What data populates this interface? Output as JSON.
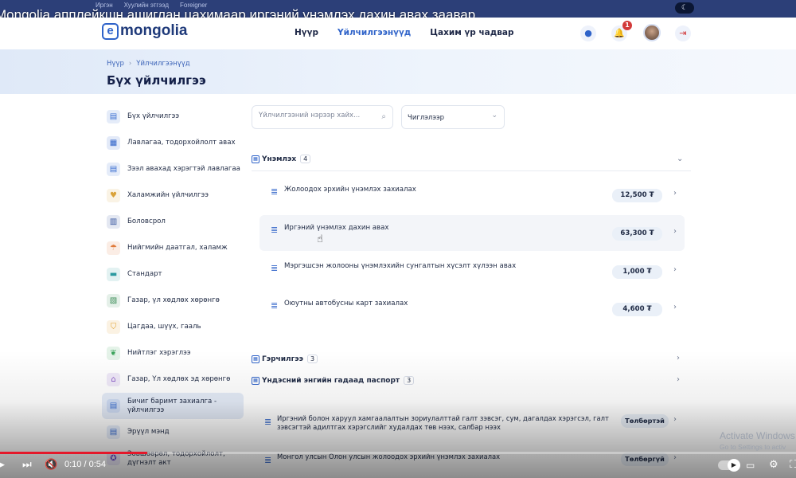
{
  "video": {
    "title": "Mongolia апплейкшн ашиглан цахимаар иргэний үнэмлэх дахин авах заавар",
    "time_current": "0:10",
    "time_total": "0:54",
    "progress": 0.185
  },
  "topbar": {
    "languages": [
      "Иргэн",
      "Хуулийн этгээд",
      "Foreigner"
    ]
  },
  "header": {
    "logo_letter": "e",
    "logo_text": "mongolia",
    "nav": [
      "Нүүр",
      "Үйлчилгээнүүд",
      "Цахим үр чадвар"
    ],
    "active_nav": "Үйлчилгээнүүд",
    "notification_count": "1"
  },
  "hero": {
    "breadcrumb": [
      "Нүүр",
      "Үйлчилгээнүүд"
    ],
    "title": "Бүх үйлчилгээ"
  },
  "sidebar": {
    "items": [
      {
        "label": "Бүх үйлчилгээ",
        "icon": "document-icon",
        "color": "#3b6fd1"
      },
      {
        "label": "Лавлагаа, тодорхойлолт авах",
        "icon": "certificate-icon",
        "color": "#2f63c9"
      },
      {
        "label": "Зээл авахад хэрэгтэй лавлагаа",
        "icon": "document-icon",
        "color": "#3b6fd1"
      },
      {
        "label": "Халамжийн үйлчилгээ",
        "icon": "care-icon",
        "color": "#d9a23a"
      },
      {
        "label": "Боловсрол",
        "icon": "building-icon",
        "color": "#35549e"
      },
      {
        "label": "Нийгмийн даатгал, халамж",
        "icon": "umbrella-icon",
        "color": "#e07a3a"
      },
      {
        "label": "Стандарт",
        "icon": "briefcase-icon",
        "color": "#2b9aa0"
      },
      {
        "label": "Газар, үл хөдлөх хөрөнгө",
        "icon": "map-icon",
        "color": "#3f8f5a"
      },
      {
        "label": "Цагдаа, шүүх, гааль",
        "icon": "shield-icon",
        "color": "#e0a02c"
      },
      {
        "label": "Нийтлэг хэрэглээ",
        "icon": "leaf-icon",
        "color": "#3aa35a"
      },
      {
        "label": "Газар, Үл хөдлөх эд хөрөнгө",
        "icon": "house-icon",
        "color": "#8a5ac8"
      },
      {
        "label": "Бичиг баримт захиалга - үйлчилгээ",
        "icon": "document-icon",
        "color": "#3b6fd1"
      },
      {
        "label": "Эрүүл мэнд",
        "icon": "document-icon",
        "color": "#3b6fd1"
      },
      {
        "label": "Зөвшөөрөл, тодорхойлолт, дүгнэлт акт",
        "icon": "badge-icon",
        "color": "#6a4fc8"
      }
    ],
    "active_index": 11
  },
  "search": {
    "placeholder": "Үйлчилгээний нэрээр хайх...",
    "sort_value": "Чиглэлээр"
  },
  "categories": [
    {
      "title": "Үнэмлэх",
      "count": "4",
      "expanded": true,
      "services": [
        {
          "title": "Жолоодох эрхийн үнэмлэх захиалах",
          "price": "12,500 ₮"
        },
        {
          "title": "Иргэний үнэмлэх дахин авах",
          "price": "63,300 ₮"
        },
        {
          "title": "Мэргэшсэн жолооны үнэмлэхийн сунгалтын хүсэлт хүлээн авах",
          "price": "1,000 ₮"
        },
        {
          "title": "Оюутны автобусны карт захиалах",
          "price": "4,600 ₮"
        }
      ]
    },
    {
      "title": "Гэрчилгээ",
      "count": "3",
      "expanded": false
    },
    {
      "title": "Үндэсний энгийн гадаад паспорт",
      "count": "3",
      "expanded": false,
      "services": [
        {
          "title": "Иргэний болон харуул хамгаалалтын зориулалттай галт зэвсэг, сум, дагалдах хэрэгсэл, галт зэвсэгтэй адилтгах хэрэгслийг худалдах төв нээх, салбар нээх",
          "price": "Төлбөртэй"
        },
        {
          "title": "Монгол улсын Олон улсын жолоодох эрхийн үнэмлэх захиалах",
          "price": "Төлбөргүй"
        }
      ]
    }
  ],
  "watermark": {
    "line1": "Activate Windows",
    "line2": "Go to Settings to activ"
  }
}
